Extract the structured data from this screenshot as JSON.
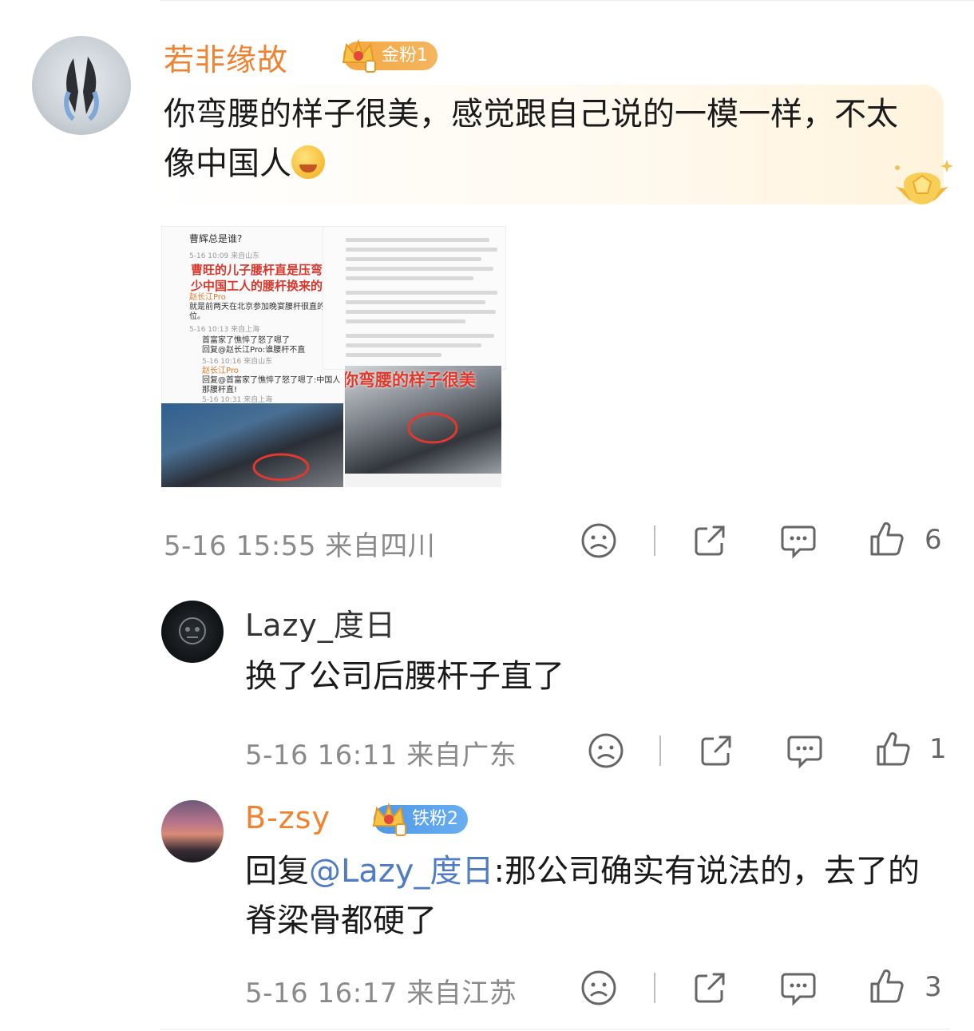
{
  "comments": [
    {
      "name": "若非缘故",
      "badge": "金粉1",
      "text": "你弯腰的样子很美，感觉跟自己说的一模一样，不太像中国人",
      "text_line1": "你弯腰的样子很美，感觉跟自己说的一模一样，不太",
      "text_line2": "像中国人",
      "meta": "5-16 15:55  来自四川",
      "likes": "6",
      "image": {
        "headline_left": "曹旺的儿子腰杆直是压弯多少中国工人的腰杆换来的?",
        "headline_left_1": "曹旺的儿子腰杆直是压弯多",
        "headline_left_2": "少中国工人的腰杆换来的?",
        "headline_right": "你弯腰的样子很美",
        "snippet_top": "曹辉总是谁?",
        "snippet_user1": "赵长江Pro",
        "snippet_text1": "就是前两天在北京参加晚宴腰杆很直的那位。",
        "snippet_text1a": "就是前两天在北京参加晚宴腰杆很直的那",
        "snippet_text1b": "位。",
        "snippet_reply1": "首富家了憔悴了怒了嗯了",
        "snippet_reply2": "回复@赵长江Pro:谁腰杆不直",
        "snippet_user2": "赵长江Pro",
        "snippet_text2": "回复@首富家了憔悴了怒了嗯了:中国人那腰杆直!",
        "snippet_text2a": "回复@首富家了憔悴了怒了嗯了:中国人",
        "snippet_text2b": "那腰杆直!",
        "ts1": "5-16 10:09  来自山东",
        "ts2": "5-16 10:13  来自上海",
        "ts3": "5-16 10:16  来自山东",
        "ts4": "5-16 10:31  来自上海"
      }
    },
    {
      "name": "Lazy_度日",
      "text": "换了公司后腰杆子直了",
      "meta": "5-16 16:11  来自广东",
      "likes": "1"
    },
    {
      "name": "B-zsy",
      "badge": "铁粉2",
      "reply_prefix": "回复",
      "mention": "@Lazy_度日",
      "text_line1": ":那公司确实有说法的，去了的",
      "text_line2": "脊梁骨都硬了",
      "meta": "5-16 16:17  来自江苏",
      "likes": "3"
    }
  ],
  "icons": [
    "frown-icon",
    "share-icon",
    "comment-icon",
    "like-icon",
    "crown-icon",
    "medal-icon"
  ],
  "colors": {
    "accent_name": "#f08331",
    "mention": "#4f7cc2",
    "meta": "#8a8a8a",
    "badge_gold": "#f3a742",
    "badge_iron": "#4c97e8"
  }
}
